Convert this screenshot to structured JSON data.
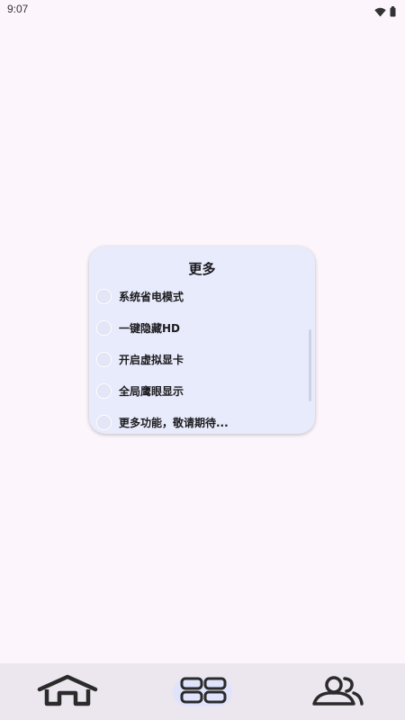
{
  "status_bar": {
    "time": "9:07",
    "icons": [
      "wifi-icon",
      "battery-icon"
    ]
  },
  "dialog": {
    "title": "更多",
    "options": [
      {
        "label": "系统省电模式",
        "selected": false
      },
      {
        "label": "一键隐藏HD",
        "selected": false
      },
      {
        "label": "开启虚拟显卡",
        "selected": false
      },
      {
        "label": "全局鹰眼显示",
        "selected": false
      },
      {
        "label": "更多功能，敬请期待...",
        "selected": false
      }
    ]
  },
  "bottom_nav": {
    "items": [
      {
        "icon": "home-icon",
        "active": false
      },
      {
        "icon": "grid-icon",
        "active": true
      },
      {
        "icon": "people-icon",
        "active": false
      }
    ]
  },
  "colors": {
    "background": "#fcf6fc",
    "dialog_background": "#e8ebfb",
    "nav_background": "#ece6ee",
    "nav_active_pill": "#dfe3fb"
  }
}
